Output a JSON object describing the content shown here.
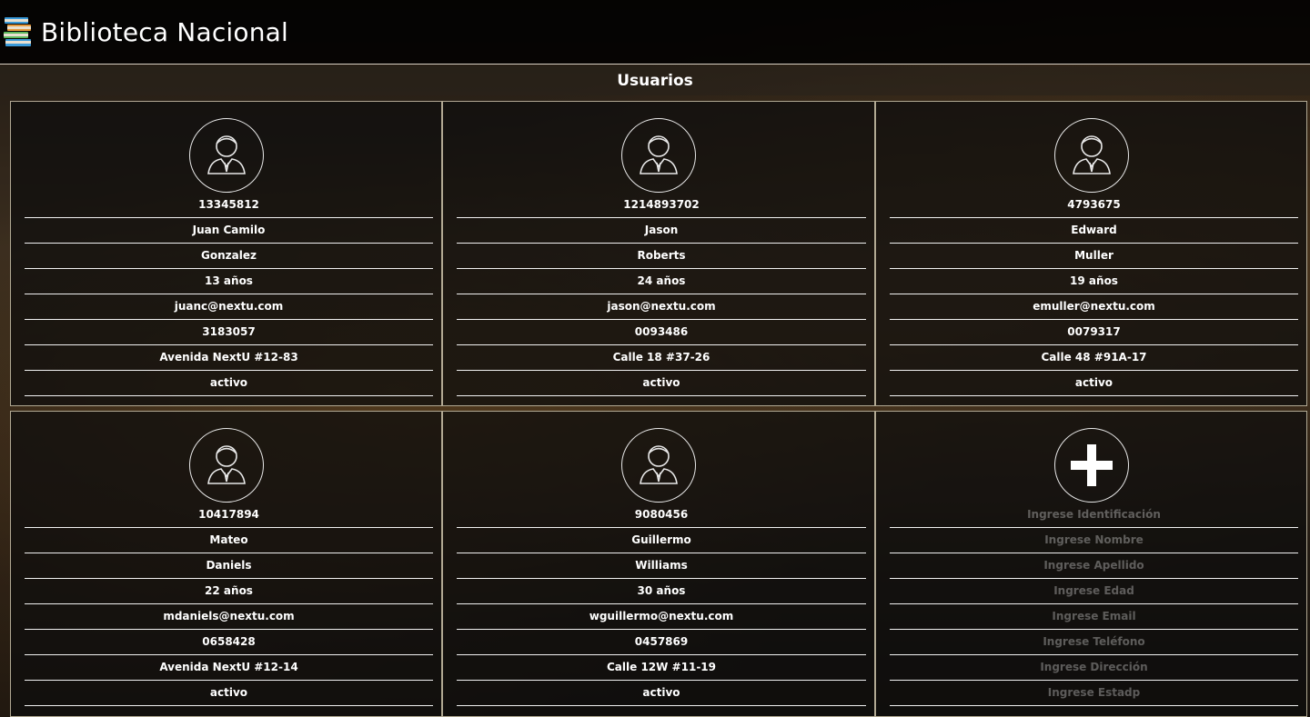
{
  "app": {
    "title": "Biblioteca Nacional"
  },
  "section": {
    "title": "Usuarios"
  },
  "users": [
    {
      "id": "13345812",
      "nombre": "Juan Camilo",
      "apellido": "Gonzalez",
      "edad": "13 años",
      "email": "juanc@nextu.com",
      "telefono": "3183057",
      "direccion": "Avenida NextU #12-83",
      "estado": "activo"
    },
    {
      "id": "1214893702",
      "nombre": "Jason",
      "apellido": "Roberts",
      "edad": "24 años",
      "email": "jason@nextu.com",
      "telefono": "0093486",
      "direccion": "Calle 18 #37-26",
      "estado": "activo"
    },
    {
      "id": "4793675",
      "nombre": "Edward",
      "apellido": "Muller",
      "edad": "19 años",
      "email": "emuller@nextu.com",
      "telefono": "0079317",
      "direccion": "Calle 48 #91A-17",
      "estado": "activo"
    },
    {
      "id": "10417894",
      "nombre": "Mateo",
      "apellido": "Daniels",
      "edad": "22 años",
      "email": "mdaniels@nextu.com",
      "telefono": "0658428",
      "direccion": "Avenida NextU #12-14",
      "estado": "activo"
    },
    {
      "id": "9080456",
      "nombre": "Guillermo",
      "apellido": "Williams",
      "edad": "30 años",
      "email": "wguillermo@nextu.com",
      "telefono": "0457869",
      "direccion": "Calle 12W #11-19",
      "estado": "activo"
    }
  ],
  "new_user_form": {
    "id_placeholder": "Ingrese Identificación",
    "nombre_placeholder": "Ingrese Nombre",
    "apellido_placeholder": "Ingrese Apellido",
    "edad_placeholder": "Ingrese Edad",
    "email_placeholder": "Ingrese Email",
    "telefono_placeholder": "Ingrese Teléfono",
    "direccion_placeholder": "Ingrese Dirección",
    "estado_placeholder": "Ingrese Estadp"
  },
  "icons": {
    "brand": "books-icon",
    "avatar": "user-avatar-icon",
    "add": "plus-icon"
  }
}
